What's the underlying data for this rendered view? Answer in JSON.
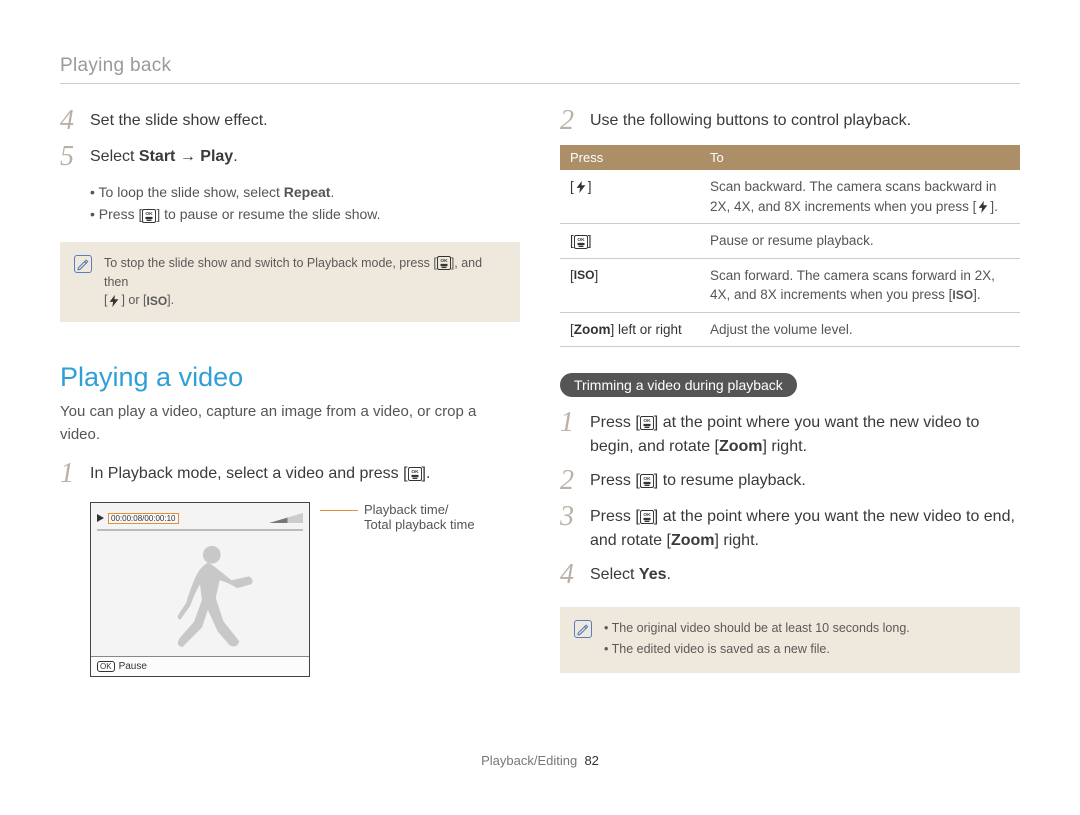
{
  "breadcrumb": "Playing back",
  "left": {
    "step4": {
      "num": "4",
      "text": "Set the slide show effect."
    },
    "step5": {
      "num": "5",
      "prefix": "Select ",
      "bold1": "Start",
      "arrow": " → ",
      "bold2": "Play",
      "suffix": "."
    },
    "sub_bullets": {
      "b1_prefix": "To loop the slide show, select ",
      "b1_bold": "Repeat",
      "b1_suffix": ".",
      "b2_prefix": "Press [",
      "b2_suffix": "] to pause or resume the slide show."
    },
    "note": {
      "line1_prefix": "To stop the slide show and switch to Playback mode, press [",
      "line1_suffix": "], and then",
      "line2_prefix": "[",
      "line2_mid": "] or [",
      "line2_iso": "ISO",
      "line2_suffix": "]."
    },
    "section_heading": "Playing a video",
    "section_para": "You can play a video, capture an image from a video, or crop a video.",
    "play_step1": {
      "num": "1",
      "prefix": "In Playback mode, select a video and press [",
      "suffix": "]."
    },
    "video_time": "00:00:08/00:00:10",
    "video_pause_label": "Pause",
    "video_ok_chip": "OK",
    "callout_l1": "Playback time/",
    "callout_l2": "Total playback time"
  },
  "right": {
    "step2": {
      "num": "2",
      "text": "Use the following buttons to control playback."
    },
    "table": {
      "h1": "Press",
      "h2": "To",
      "rows": [
        {
          "press_prefix": "[",
          "press_suffix": "]",
          "to_prefix": "Scan backward. The camera scans backward in 2X, 4X, and 8X increments when you press [",
          "to_suffix": "]."
        },
        {
          "press_prefix": "[",
          "press_suffix": "]",
          "to": "Pause or resume playback."
        },
        {
          "press_prefix": "[",
          "press_iso": "ISO",
          "press_suffix": "]",
          "to_prefix": "Scan forward. The camera scans forward in 2X, 4X, and 8X increments when you press [",
          "to_iso": "ISO",
          "to_suffix": "]."
        },
        {
          "press_prefix": "[",
          "press_label": "Zoom",
          "press_suffix": "] left or right",
          "to": "Adjust the volume level."
        }
      ]
    },
    "pill": "Trimming a video during playback",
    "trim_steps": {
      "s1": {
        "num": "1",
        "prefix": "Press [",
        "mid": "] at the point where you want the new video to begin, and rotate [",
        "bold": "Zoom",
        "suffix": "] right."
      },
      "s2": {
        "num": "2",
        "prefix": "Press [",
        "suffix": "] to resume playback."
      },
      "s3": {
        "num": "3",
        "prefix": "Press [",
        "mid": "] at the point where you want the new video to end, and rotate [",
        "bold": "Zoom",
        "suffix": "] right."
      },
      "s4": {
        "num": "4",
        "prefix": "Select ",
        "bold": "Yes",
        "suffix": "."
      }
    },
    "note": {
      "b1": "The original video should be at least 10 seconds long.",
      "b2": "The edited video is saved as a new file."
    }
  },
  "footer": {
    "section": "Playback/Editing",
    "page": "82"
  }
}
